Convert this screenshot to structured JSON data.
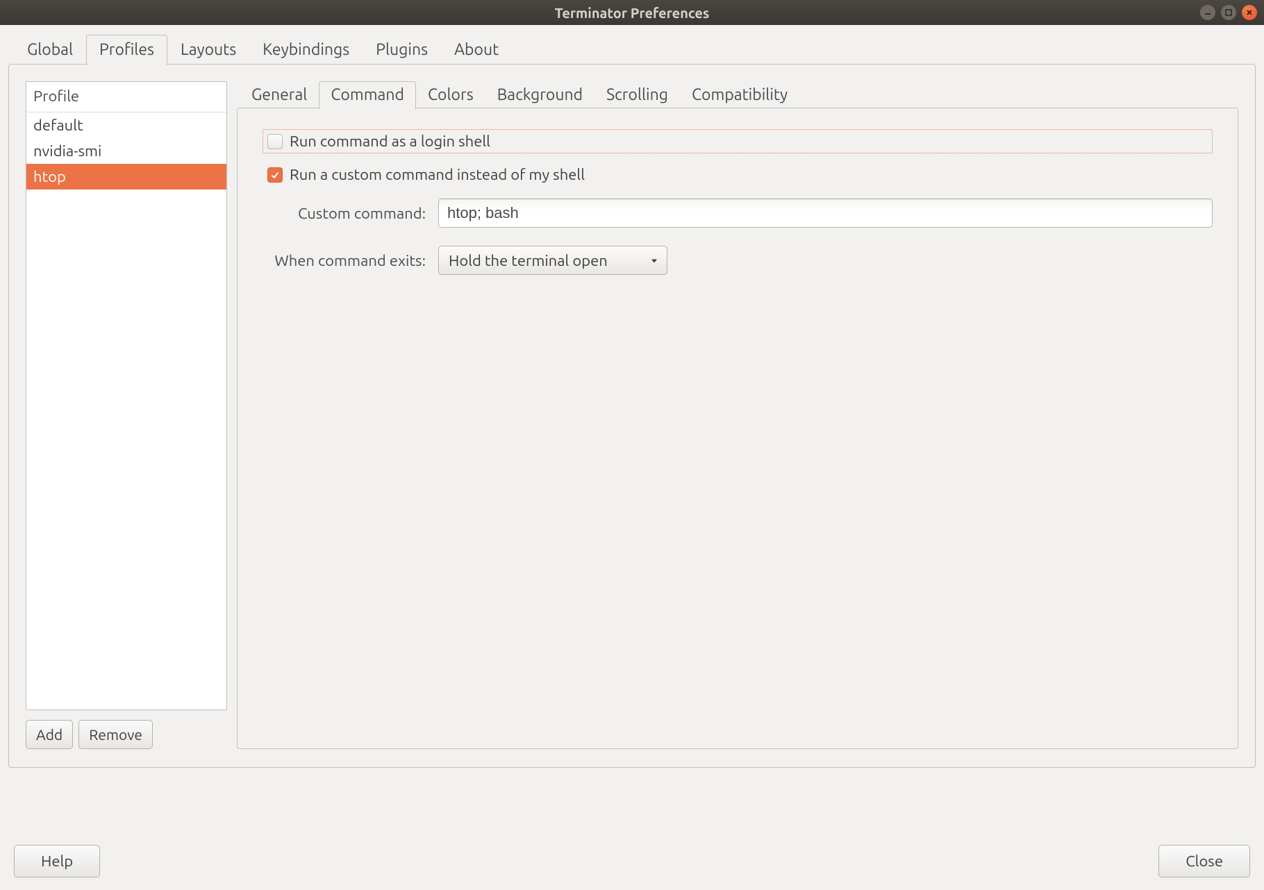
{
  "window": {
    "title": "Terminator Preferences"
  },
  "main_tabs": [
    "Global",
    "Profiles",
    "Layouts",
    "Keybindings",
    "Plugins",
    "About"
  ],
  "main_tab_active": 1,
  "profile_list": {
    "header": "Profile",
    "items": [
      "default",
      "nvidia-smi",
      "htop"
    ],
    "selected": 2,
    "add_label": "Add",
    "remove_label": "Remove"
  },
  "sub_tabs": [
    "General",
    "Command",
    "Colors",
    "Background",
    "Scrolling",
    "Compatibility"
  ],
  "sub_tab_active": 1,
  "command_form": {
    "login_shell_label": "Run command as a login shell",
    "login_shell_checked": false,
    "custom_cmd_enabled_label": "Run a custom command instead of my shell",
    "custom_cmd_enabled_checked": true,
    "custom_cmd_label": "Custom command:",
    "custom_cmd_value": "htop; bash",
    "exit_label": "When command exits:",
    "exit_value": "Hold the terminal open"
  },
  "footer": {
    "help": "Help",
    "close": "Close"
  },
  "colors": {
    "accent": "#ec7345"
  }
}
